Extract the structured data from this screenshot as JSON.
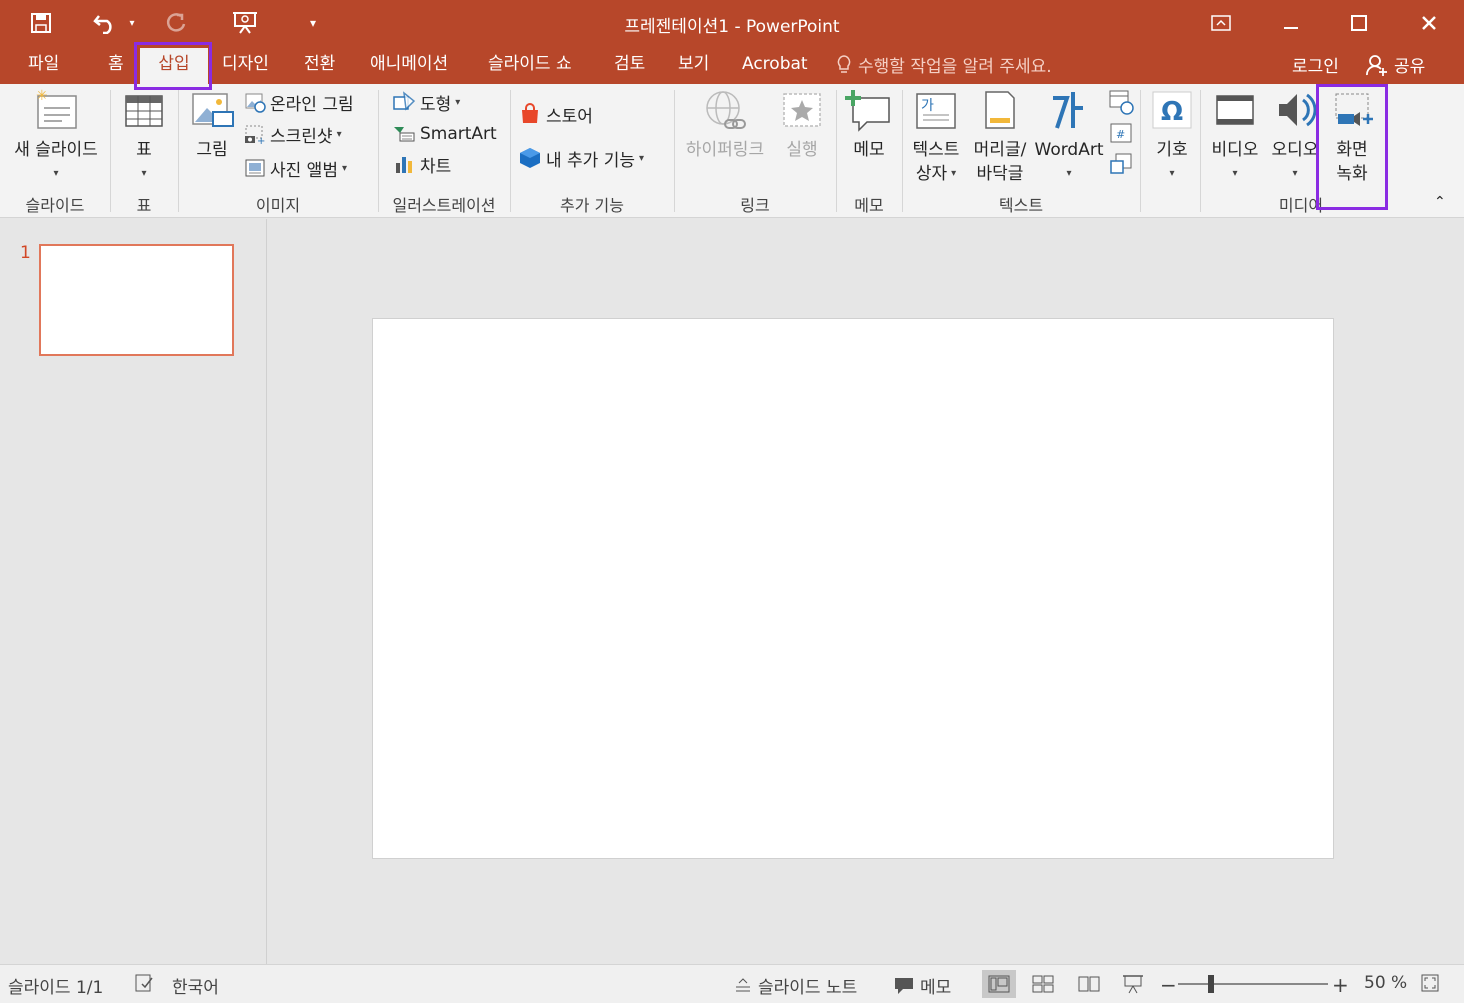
{
  "app": {
    "title": "프레젠테이션1 - PowerPoint"
  },
  "tabs": [
    {
      "label": "파일"
    },
    {
      "label": "홈"
    },
    {
      "label": "삽입"
    },
    {
      "label": "디자인"
    },
    {
      "label": "전환"
    },
    {
      "label": "애니메이션"
    },
    {
      "label": "슬라이드 쇼"
    },
    {
      "label": "검토"
    },
    {
      "label": "보기"
    },
    {
      "label": "Acrobat"
    }
  ],
  "tell_me": "수행할 작업을 알려 주세요.",
  "login": "로그인",
  "share": "공유",
  "ribbon": {
    "slides": {
      "new_slide": "새 슬라이드",
      "group": "슬라이드"
    },
    "tables": {
      "table": "표",
      "group": "표"
    },
    "images": {
      "picture": "그림",
      "online_pictures": "온라인 그림",
      "screenshot": "스크린샷",
      "photo_album": "사진 앨범",
      "group": "이미지"
    },
    "illustrations": {
      "shapes": "도형",
      "smartart": "SmartArt",
      "chart": "차트",
      "group": "일러스트레이션"
    },
    "addins": {
      "store": "스토어",
      "my_addins": "내 추가 기능",
      "group": "추가 기능"
    },
    "links": {
      "hyperlink": "하이퍼링크",
      "action": "실행",
      "group": "링크"
    },
    "comments": {
      "comment": "메모",
      "group": "메모"
    },
    "text": {
      "textbox_1": "텍스트",
      "textbox_2": "상자",
      "header_1": "머리글/",
      "header_2": "바닥글",
      "wordart": "WordArt",
      "group": "텍스트"
    },
    "symbols": {
      "symbol": "기호"
    },
    "media": {
      "video": "비디오",
      "audio": "오디오",
      "screen_rec_1": "화면",
      "screen_rec_2": "녹화",
      "group": "미디어"
    }
  },
  "thumbnails": [
    {
      "number": "1"
    }
  ],
  "status": {
    "slide_info": "슬라이드 1/1",
    "language": "한국어",
    "notes": "슬라이드 노트",
    "comments": "메모",
    "zoom": "50 %",
    "zoom_fraction": 0.22
  },
  "colors": {
    "accent": "#b7472a",
    "highlight": "#8a2be2"
  }
}
